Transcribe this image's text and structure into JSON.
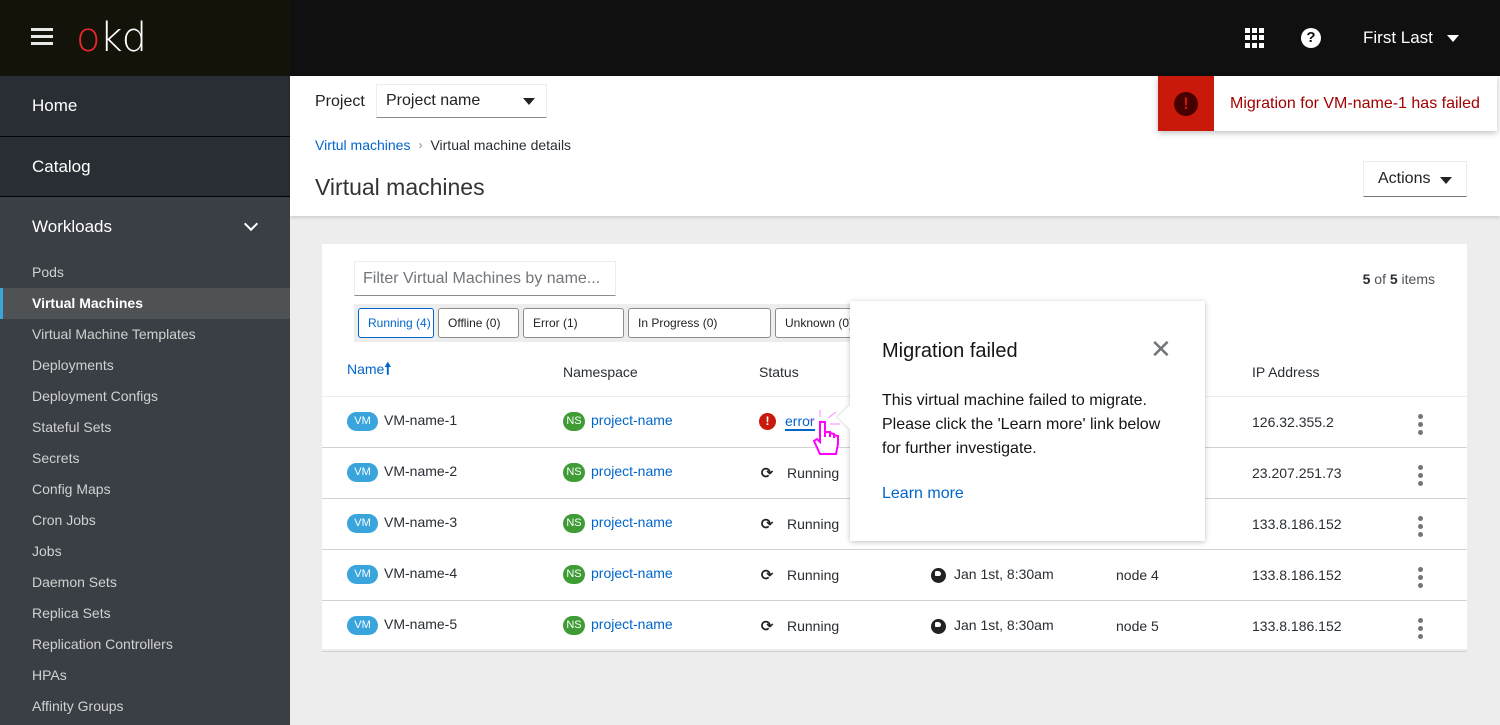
{
  "masthead": {
    "logo_o": "o",
    "logo_kd": "kd",
    "user_name": "First Last",
    "icons": [
      "hamburger-menu-icon",
      "app-launcher-icon",
      "help-icon"
    ]
  },
  "sidebar": {
    "top_items": [
      {
        "label": "Home"
      },
      {
        "label": "Catalog"
      }
    ],
    "section": {
      "label": "Workloads",
      "expanded": true
    },
    "sub_items": [
      {
        "label": "Pods",
        "active": false
      },
      {
        "label": "Virtual Machines",
        "active": true
      },
      {
        "label": "Virtual Machine Templates",
        "active": false
      },
      {
        "label": "Deployments",
        "active": false
      },
      {
        "label": "Deployment Configs",
        "active": false
      },
      {
        "label": "Stateful Sets",
        "active": false
      },
      {
        "label": "Secrets",
        "active": false
      },
      {
        "label": "Config Maps",
        "active": false
      },
      {
        "label": "Cron Jobs",
        "active": false
      },
      {
        "label": "Jobs",
        "active": false
      },
      {
        "label": "Daemon Sets",
        "active": false
      },
      {
        "label": "Replica Sets",
        "active": false
      },
      {
        "label": "Replication Controllers",
        "active": false
      },
      {
        "label": "HPAs",
        "active": false
      },
      {
        "label": "Affinity Groups",
        "active": false
      }
    ]
  },
  "header": {
    "project_label": "Project",
    "project_value": "Project name",
    "breadcrumb": [
      {
        "label": "Virtul machines",
        "link": true
      },
      {
        "label": "Virtual machine details",
        "link": false
      }
    ],
    "title": "Virtual machines",
    "actions_label": "Actions"
  },
  "toast": {
    "message": "Migration for VM-name-1 has failed",
    "type": "danger"
  },
  "list": {
    "filter_placeholder": "Filter Virtual Machines by name...",
    "count_shown": "5",
    "count_of": "of",
    "count_total": "5",
    "count_suffix": "items",
    "status_filters": [
      {
        "label": "Running (4)",
        "active": true
      },
      {
        "label": "Offline (0)",
        "active": false
      },
      {
        "label": "Error (1)",
        "active": false
      },
      {
        "label": "In Progress (0)",
        "active": false
      },
      {
        "label": "Unknown (0)",
        "active": false
      }
    ],
    "columns": [
      "Name",
      "Namespace",
      "Status",
      "",
      "",
      "IP Address"
    ],
    "sort_column": "Name",
    "sort_direction": "ascending",
    "vm_badge": "VM",
    "ns_badge": "NS",
    "rows": [
      {
        "name": "VM-name-1",
        "namespace": "project-name",
        "status": "error",
        "status_type": "error",
        "date": "",
        "node": "",
        "ip": "126.32.355.2"
      },
      {
        "name": "VM-name-2",
        "namespace": "project-name",
        "status": "Running",
        "status_type": "running",
        "date": "",
        "node": "",
        "ip": "23.207.251.73"
      },
      {
        "name": "VM-name-3",
        "namespace": "project-name",
        "status": "Running",
        "status_type": "running",
        "date": "",
        "node": "",
        "ip": "133.8.186.152"
      },
      {
        "name": "VM-name-4",
        "namespace": "project-name",
        "status": "Running",
        "status_type": "running",
        "date": "Jan 1st, 8:30am",
        "node": "node 4",
        "ip": "133.8.186.152"
      },
      {
        "name": "VM-name-5",
        "namespace": "project-name",
        "status": "Running",
        "status_type": "running",
        "date": "Jan 1st, 8:30am",
        "node": "node 5",
        "ip": "133.8.186.152"
      }
    ]
  },
  "popover": {
    "title": "Migration failed",
    "body": "This virtual machine failed to migrate. Please click the 'Learn more' link below for further investigate.",
    "link": "Learn more",
    "close_glyph": "✕"
  },
  "colors": {
    "accent": "#0066cc",
    "danger": "#c9190b",
    "vm_badge": "#39a5dc",
    "ns_badge": "#3f9c35",
    "active_nav_bar": "#39a5dc"
  }
}
